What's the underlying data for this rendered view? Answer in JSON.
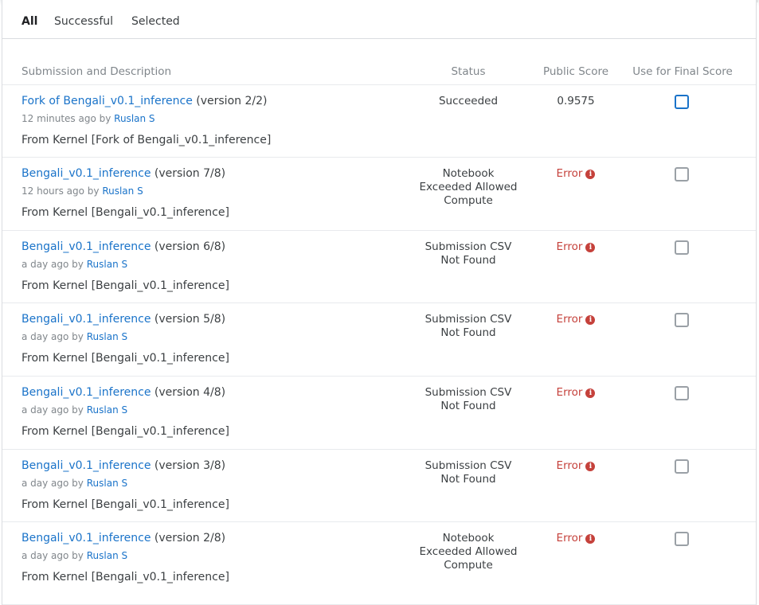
{
  "tabs": [
    "All",
    "Successful",
    "Selected"
  ],
  "columns": {
    "submission": "Submission and Description",
    "status": "Status",
    "score": "Public Score",
    "final": "Use for Final Score"
  },
  "rows": [
    {
      "name": "Fork of Bengali_v0.1_inference",
      "version": "(version 2/2)",
      "time": "12 minutes ago by",
      "user": "Ruslan S",
      "desc": "From Kernel [Fork of Bengali_v0.1_inference]",
      "status_lines": [
        "Succeeded"
      ],
      "score": "0.9575",
      "is_error": false
    },
    {
      "name": "Bengali_v0.1_inference",
      "version": "(version 7/8)",
      "time": "12 hours ago by",
      "user": "Ruslan S",
      "desc": "From Kernel [Bengali_v0.1_inference]",
      "status_lines": [
        "Notebook",
        "Exceeded Allowed",
        "Compute"
      ],
      "score": "Error",
      "is_error": true
    },
    {
      "name": "Bengali_v0.1_inference",
      "version": "(version 6/8)",
      "time": "a day ago by",
      "user": "Ruslan S",
      "desc": "From Kernel [Bengali_v0.1_inference]",
      "status_lines": [
        "Submission CSV",
        "Not Found"
      ],
      "score": "Error",
      "is_error": true
    },
    {
      "name": "Bengali_v0.1_inference",
      "version": "(version 5/8)",
      "time": "a day ago by",
      "user": "Ruslan S",
      "desc": "From Kernel [Bengali_v0.1_inference]",
      "status_lines": [
        "Submission CSV",
        "Not Found"
      ],
      "score": "Error",
      "is_error": true
    },
    {
      "name": "Bengali_v0.1_inference",
      "version": "(version 4/8)",
      "time": "a day ago by",
      "user": "Ruslan S",
      "desc": "From Kernel [Bengali_v0.1_inference]",
      "status_lines": [
        "Submission CSV",
        "Not Found"
      ],
      "score": "Error",
      "is_error": true
    },
    {
      "name": "Bengali_v0.1_inference",
      "version": "(version 3/8)",
      "time": "a day ago by",
      "user": "Ruslan S",
      "desc": "From Kernel [Bengali_v0.1_inference]",
      "status_lines": [
        "Submission CSV",
        "Not Found"
      ],
      "score": "Error",
      "is_error": true
    },
    {
      "name": "Bengali_v0.1_inference",
      "version": "(version 2/8)",
      "time": "a day ago by",
      "user": "Ruslan S",
      "desc": "From Kernel [Bengali_v0.1_inference]",
      "status_lines": [
        "Notebook",
        "Exceeded Allowed",
        "Compute"
      ],
      "score": "Error",
      "is_error": true
    }
  ],
  "icons": {
    "error_info": "info-circle-icon"
  },
  "colors": {
    "link": "#1a73c9",
    "error": "#c5413b",
    "text": "#3c4043",
    "muted": "#80868b"
  }
}
